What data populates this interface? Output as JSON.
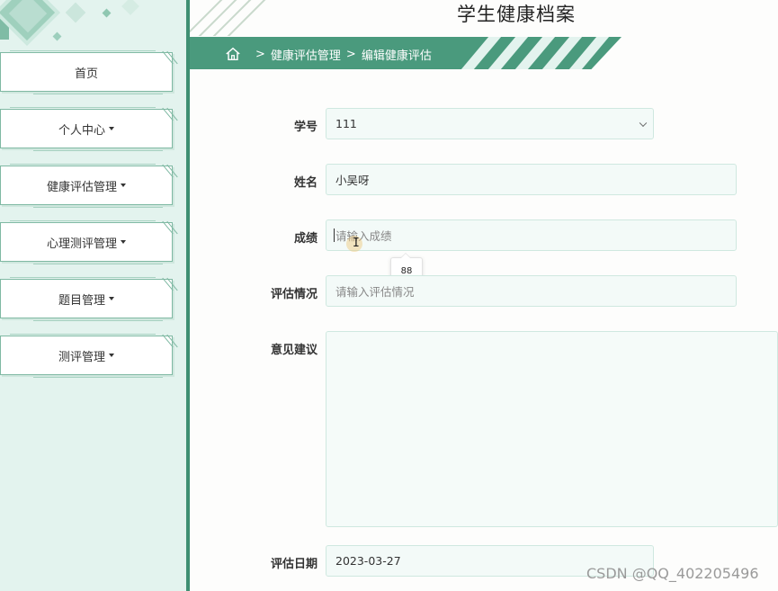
{
  "header": {
    "title": "学生健康档案"
  },
  "breadcrumb": {
    "items": [
      "健康评估管理",
      "编辑健康评估"
    ],
    "separator": ">"
  },
  "sidebar": {
    "items": [
      {
        "label": "首页",
        "has_caret": false
      },
      {
        "label": "个人中心",
        "has_caret": true
      },
      {
        "label": "健康评估管理",
        "has_caret": true
      },
      {
        "label": "心理测评管理",
        "has_caret": true
      },
      {
        "label": "题目管理",
        "has_caret": true
      },
      {
        "label": "测评管理",
        "has_caret": true
      }
    ]
  },
  "form": {
    "student_id": {
      "label": "学号",
      "value": "111"
    },
    "name": {
      "label": "姓名",
      "value": "小吴呀"
    },
    "score": {
      "label": "成绩",
      "placeholder": "请输入成绩",
      "autocomplete_suggestion": "88"
    },
    "evaluation": {
      "label": "评估情况",
      "placeholder": "请输入评估情况"
    },
    "advice": {
      "label": "意见建议",
      "value": ""
    },
    "date": {
      "label": "评估日期",
      "value": "2023-03-27"
    }
  },
  "watermark": "CSDN @QQ_402205496",
  "colors": {
    "accent": "#4a9a7d",
    "sidebar_bg": "#e3f3ee",
    "field_bg": "#f3faf8"
  },
  "icons": {
    "home": "home-icon",
    "dropdown": "caret-down-icon",
    "select": "chevron-down-icon"
  }
}
